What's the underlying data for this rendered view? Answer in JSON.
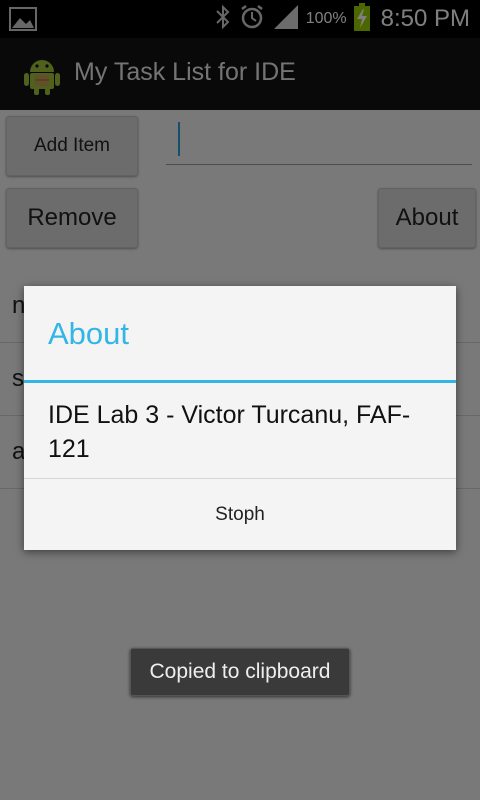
{
  "status_bar": {
    "time": "8:50 PM",
    "battery_percent": "100%",
    "icons": [
      "image-icon",
      "bluetooth-icon",
      "alarm-icon",
      "signal-icon",
      "battery-charging-icon"
    ]
  },
  "action_bar": {
    "title": "My Task List for IDE",
    "icon": "android-icon"
  },
  "controls": {
    "add_label": "Add Item",
    "remove_label": "Remove",
    "about_label": "About",
    "input_value": ""
  },
  "list": {
    "items": [
      "n",
      "s",
      "a"
    ]
  },
  "dialog": {
    "title": "About",
    "message": "IDE Lab 3 - Victor Turcanu, FAF-121",
    "button_label": "Stoph"
  },
  "toast": {
    "text": "Copied to clipboard"
  },
  "colors": {
    "accent": "#33b5e5",
    "action_bar": "#121212",
    "status_bar": "#000000",
    "battery": "#99cc00"
  }
}
